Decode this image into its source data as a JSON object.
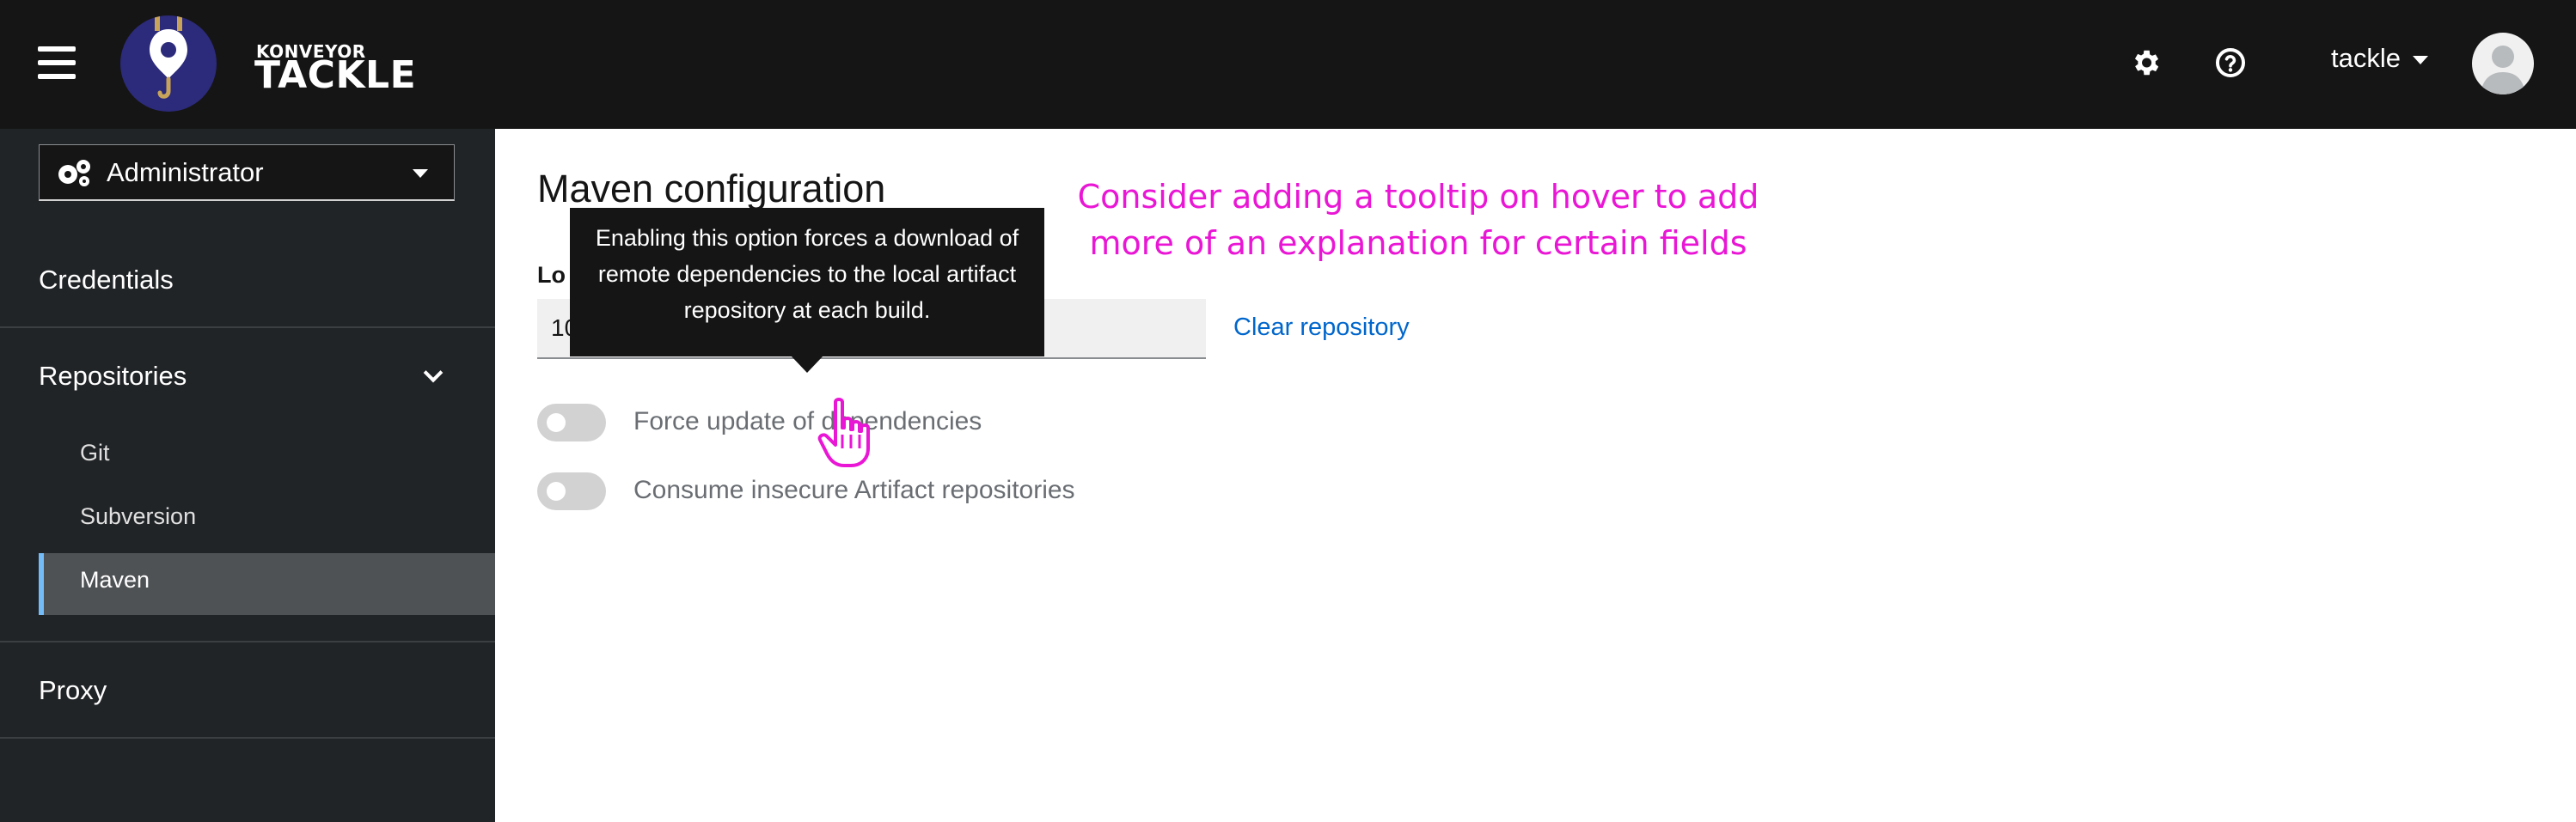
{
  "header": {
    "brand_small": "KONVEYOR",
    "brand_big": "TACKLE",
    "user_name": "tackle",
    "icons": [
      "menu-icon",
      "gear-icon",
      "help-icon",
      "caret-down-icon",
      "avatar"
    ]
  },
  "sidebar": {
    "perspective": "Administrator",
    "items": {
      "credentials": "Credentials",
      "repositories": "Repositories",
      "git": "Git",
      "subversion": "Subversion",
      "maven": "Maven",
      "proxy": "Proxy"
    },
    "active_item": "Maven"
  },
  "main": {
    "title": "Maven configuration",
    "field_label": "Lo",
    "field_value": "10",
    "clear_button": "Clear repository",
    "switches": {
      "force_update": "Force update of dependencies",
      "consume_insecure": "Consume insecure Artifact repositories"
    }
  },
  "tooltip": {
    "text_line1": "Enabling this option forces a download of",
    "text_line2": "remote dependencies to the local artifact",
    "text_line3": "repository at each build."
  },
  "annotation": {
    "line1": "Consider adding a tooltip on hover to add",
    "line2": "more of an explanation for certain fields"
  },
  "colors": {
    "header_bg": "#151515",
    "sidebar_bg": "#212427",
    "active_item_bg": "#4f5255",
    "active_marker": "#73bcf7",
    "link": "#0066cc",
    "annotation": "#ea16d5"
  }
}
